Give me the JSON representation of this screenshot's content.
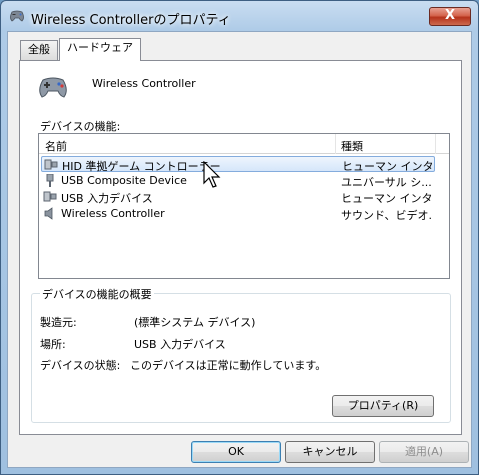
{
  "window": {
    "title": "Wireless Controllerのプロパティ",
    "close_label": "X"
  },
  "tabs": [
    {
      "label": "全般"
    },
    {
      "label": "ハードウェア"
    }
  ],
  "device": {
    "name": "Wireless Controller"
  },
  "functions_label": "デバイスの機能:",
  "list": {
    "columns": {
      "name": "名前",
      "type": "種類"
    },
    "rows": [
      {
        "name": "HID 準拠ゲーム コントローラー",
        "type": "ヒューマン インタ...",
        "icon": "hid-device-icon"
      },
      {
        "name": "USB Composite Device",
        "type": "ユニバーサル シ...",
        "icon": "usb-plug-icon"
      },
      {
        "name": "USB 入力デバイス",
        "type": "ヒューマン インタ...",
        "icon": "hid-device-icon"
      },
      {
        "name": "Wireless Controller",
        "type": "サウンド、ビデオ...",
        "icon": "speaker-icon"
      }
    ]
  },
  "summary": {
    "legend": "デバイスの機能の概要",
    "manufacturer_label": "製造元:",
    "manufacturer_value": "(標準システム デバイス)",
    "location_label": "場所:",
    "location_value": "USB 入力デバイス",
    "status_label": "デバイスの状態:",
    "status_value": "このデバイスは正常に動作しています。",
    "properties_button": "プロパティ(R)"
  },
  "buttons": {
    "ok": "OK",
    "cancel": "キャンセル",
    "apply": "適用(A)"
  }
}
